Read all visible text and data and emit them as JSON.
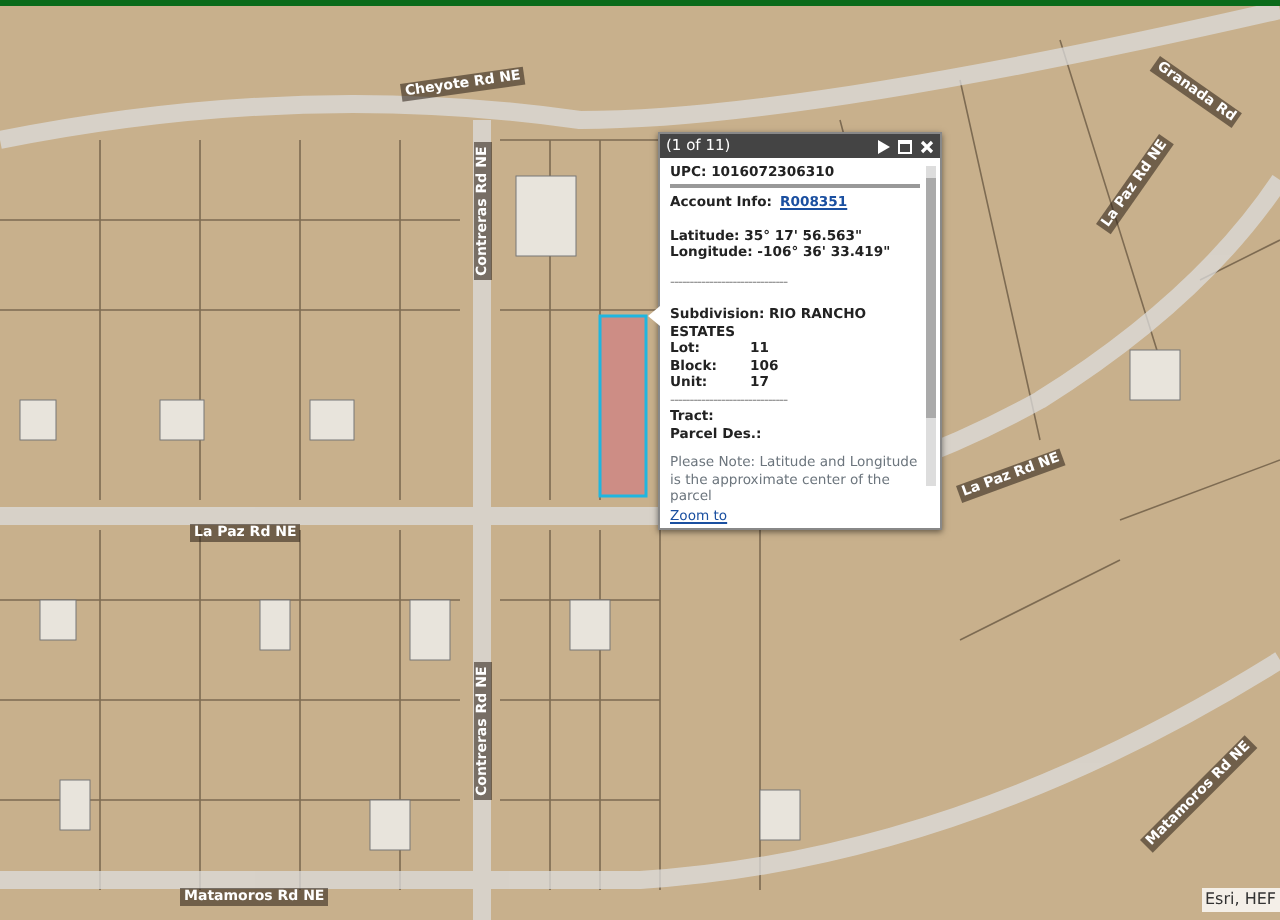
{
  "map": {
    "road_labels": [
      {
        "text": "Cheyote Rd NE",
        "kind": "angled"
      },
      {
        "text": "Contreras Rd NE",
        "kind": "vertical"
      },
      {
        "text": "Contreras Rd NE",
        "kind": "vertical"
      },
      {
        "text": "La Paz Rd NE",
        "kind": "horizontal"
      },
      {
        "text": "La Paz Rd NE",
        "kind": "angled"
      },
      {
        "text": "La Paz Rd NE",
        "kind": "steep"
      },
      {
        "text": "Matamoros Rd NE",
        "kind": "horizontal"
      },
      {
        "text": "Matamoros Rd NE",
        "kind": "steep"
      },
      {
        "text": "Granada Rd",
        "kind": "angled"
      }
    ],
    "attribution": "Esri, HEF"
  },
  "popup": {
    "title": "(1 of 11)",
    "upc": "UPC: 1016072306310",
    "account_label": "Account Info:",
    "account_link": "R008351",
    "latitude": "Latitude: 35° 17' 56.563\"",
    "longitude": "Longitude: -106° 36' 33.419\"",
    "separator": "------------------------------",
    "subdivision": "Subdivision: RIO RANCHO ESTATES",
    "fields": [
      {
        "label": "Lot:",
        "value": "11"
      },
      {
        "label": "Block:",
        "value": "106"
      },
      {
        "label": "Unit:",
        "value": "17"
      }
    ],
    "separator_2": "------------------------------",
    "tract": "Tract:",
    "parcel_des": "Parcel Des.:",
    "note": "Please Note: Latitude and Longitude is the approximate center of the parcel",
    "zoom_link": "Zoom to"
  }
}
